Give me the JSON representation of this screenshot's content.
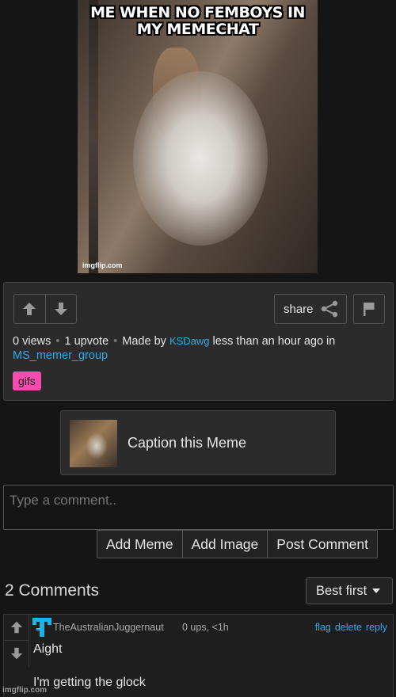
{
  "meme": {
    "caption": "ME WHEN NO FEMBOYS IN MY MEMECHAT",
    "watermark": "imgflip.com"
  },
  "info": {
    "share_label": "share",
    "views": "0 views",
    "upvotes": "1 upvote",
    "made_by_prefix": "Made by",
    "author": "KSDawg",
    "time_text": "less than an hour ago in",
    "stream": "MS_memer_group",
    "tag": "gifs",
    "tag_color": "#f64bb0"
  },
  "caption_card": {
    "label": "Caption this Meme"
  },
  "comment_form": {
    "placeholder": "Type a comment..",
    "buttons": [
      "Add Meme",
      "Add Image",
      "Post Comment"
    ]
  },
  "comments_section": {
    "count_label": "2 Comments",
    "sort_value": "Best first"
  },
  "comment": {
    "username": "TheAustralianJuggernaut",
    "stats": "0 ups, <1h",
    "actions": [
      "flag",
      "delete",
      "reply"
    ],
    "line1": "Aight",
    "line2": "I'm getting the glock",
    "avatar_color": "#1ab3e8"
  },
  "site_watermark": "imgflip.com",
  "colors": {
    "link": "#31a9e8",
    "background": "#151515",
    "panel": "#2b2b2b"
  }
}
